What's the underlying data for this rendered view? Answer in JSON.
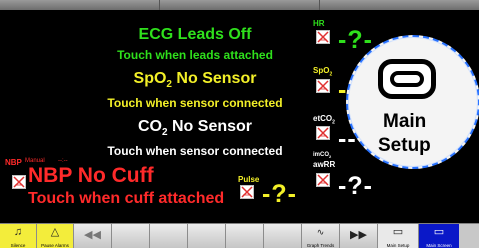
{
  "alarms": {
    "ecg_title": "ECG Leads Off",
    "ecg_sub": "Touch when leads attached",
    "spo2_title": "SpO",
    "spo2_sub_2": "2",
    "spo2_title_rest": " No Sensor",
    "spo2_sub": "Touch when sensor connected",
    "co2_title": "CO",
    "co2_sub_2": "2",
    "co2_title_rest": " No Sensor",
    "co2_sub": "Touch when sensor connected",
    "nbp_title": "NBP No Cuff",
    "nbp_sub": "Touch when cuff attached"
  },
  "params": {
    "hr_label": "HR",
    "spo2_label": "SpO",
    "spo2_label_sub": "2",
    "etco2_label": "etCO",
    "etco2_label_sub": "2",
    "imco2_label": "imCO",
    "imco2_label_sub": "2",
    "awrr_label": "awRR",
    "nbp_label": "NBP",
    "nbp_mode": "Manual",
    "nbp_dashes": "--:--",
    "pulse_label": "Pulse",
    "hr_value": "-?-",
    "spo2_value": "-?",
    "etco2_value": "--",
    "awrr_value": "-?-",
    "pulse_value": "-?-"
  },
  "magnifier": {
    "label_line1": "Main",
    "label_line2": "Setup"
  },
  "toolbar": {
    "silence": "Silence",
    "pause_alarms": "Pause Alarms",
    "graph_trends": "Graph Trends",
    "main_setup": "Main Setup",
    "main_screen": "Main Screen"
  },
  "colors": {
    "ecg": "#2fe01c",
    "spo2": "#f3f028",
    "co2": "#ffffff",
    "nbp": "#ff2a2a",
    "selected": "#0a18c8"
  }
}
